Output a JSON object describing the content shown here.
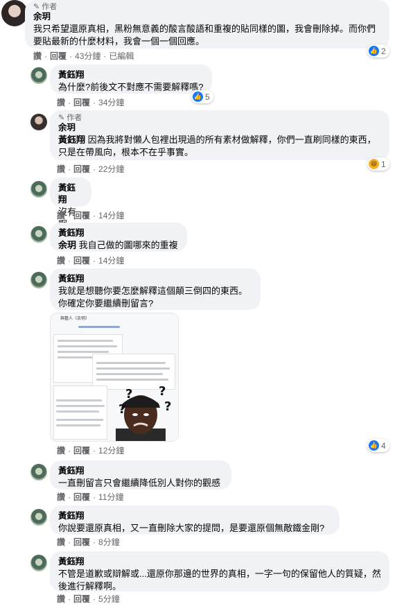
{
  "labels": {
    "author": "作者",
    "like": "讚",
    "reply": "回覆",
    "edited": "已編輯",
    "dot": "·"
  },
  "comments": [
    {
      "author_name": "余玥",
      "text": "我只希望還原真相，黑粉無意義的酸言酸語和重複的貼同樣的圖，我會刪除掉。而你們要貼最新的什麼材料，我會一個一個回應。",
      "time": "43分鐘",
      "reaction_count": "2"
    },
    {
      "author_name": "黃鈺翔",
      "text": "為什麼?前後文不對應不需要解釋嗎?",
      "time": "34分鐘",
      "reaction_count": "5"
    },
    {
      "author_name": "余玥",
      "mention": "黃鈺翔",
      "text": " 因為我將對懶人包裡出現過的所有素材做解釋，你們一直刷同樣的東西，只是在帶風向，根本不在乎事實。",
      "time": "22分鐘",
      "reaction_count": "1"
    },
    {
      "author_name": "黃鈺翔",
      "text": "沒有啊",
      "time": "14分鐘"
    },
    {
      "author_name": "黃鈺翔",
      "mention": "余玥",
      "text": " 我自己做的圖哪來的重複",
      "time": "14分鐘"
    },
    {
      "author_name": "黃鈺翔",
      "text": "我就是想聽你要怎麼解釋這個顛三倒四的東西。\n你確定你要繼續刪留言?",
      "time": "12分鐘",
      "reaction_count": "4"
    },
    {
      "author_name": "黃鈺翔",
      "text": "一直刪留言只會繼續降低別人對你的觀感",
      "time": "11分鐘"
    },
    {
      "author_name": "黃鈺翔",
      "text": "你說要還原真相，又一直刪除大家的提問，是要還原個無敵鐵金剛?",
      "time": "8分鐘"
    },
    {
      "author_name": "黃鈺翔",
      "text": "不管是道歉或辯解或...還原你那邊的世界的真相，一字一句的保留他人的質疑，然後進行解釋啊。",
      "time": "5分鐘"
    }
  ],
  "attachment": {
    "header": "與藝人（余玥）"
  },
  "colors": {
    "bubble": "#f0f2f5",
    "like_blue": "#1877f2",
    "muted": "#65676b",
    "haha": "#f7b125"
  },
  "icons": {
    "pen": "pencil-icon",
    "like": "like-icon",
    "haha": "haha-icon"
  }
}
